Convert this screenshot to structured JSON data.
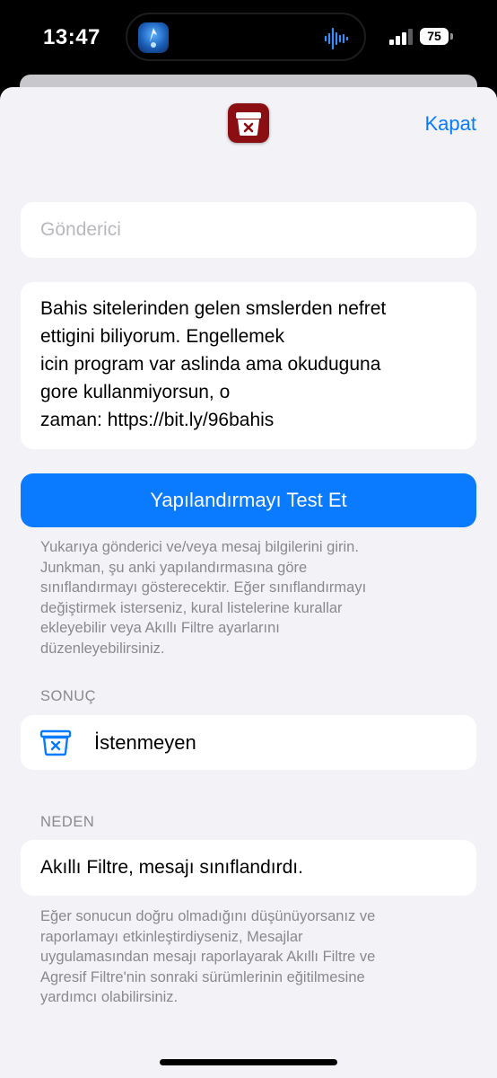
{
  "status_bar": {
    "time": "13:47",
    "battery": "75",
    "icons": [
      "app-icon",
      "audio-waveform-icon",
      "cellular-signal-icon",
      "battery-icon"
    ]
  },
  "sheet": {
    "app_icon": "junk-box-icon",
    "close_label": "Kapat"
  },
  "form": {
    "sender_placeholder": "Gönderici",
    "sender_value": "",
    "message": "Bahis sitelerinden gelen smslerden nefret\nettigini biliyorum. Engellemek\nicin program var aslinda ama okuduguna\ngore kullanmiyorsun, o\nzaman: https://bit.ly/96bahis",
    "test_button_label": "Yapılandırmayı Test Et",
    "help_text": "Yukarıya gönderici ve/veya mesaj bilgilerini girin.\nJunkman, şu anki yapılandırmasına göre\nsınıflandırmayı gösterecektir. Eğer sınıflandırmayı\ndeğiştirmek isterseniz, kural listelerine kurallar\nekleyebilir veya Akıllı Filtre ayarlarını\ndüzenleyebilirsiniz."
  },
  "result": {
    "header": "SONUÇ",
    "icon": "junk-tray-icon",
    "value": "İstenmeyen"
  },
  "reason": {
    "header": "NEDEN",
    "value": "Akıllı Filtre, mesajı sınıflandırdı.",
    "footer": "Eğer sonucun doğru olmadığını düşünüyorsanız ve\nraporlamayı etkinleştirdiyseniz, Mesajlar\nuygulamasından mesajı raporlayarak Akıllı Filtre ve\nAgresif Filtre'nin sonraki sürümlerinin eğitilmesine\nyardımcı olabilirsiniz."
  },
  "colors": {
    "accent": "#0a7aff",
    "background": "#f2f2f7",
    "card": "#ffffff",
    "secondary_text": "#8a8a8e",
    "app_icon_red": "#8b0f12"
  }
}
